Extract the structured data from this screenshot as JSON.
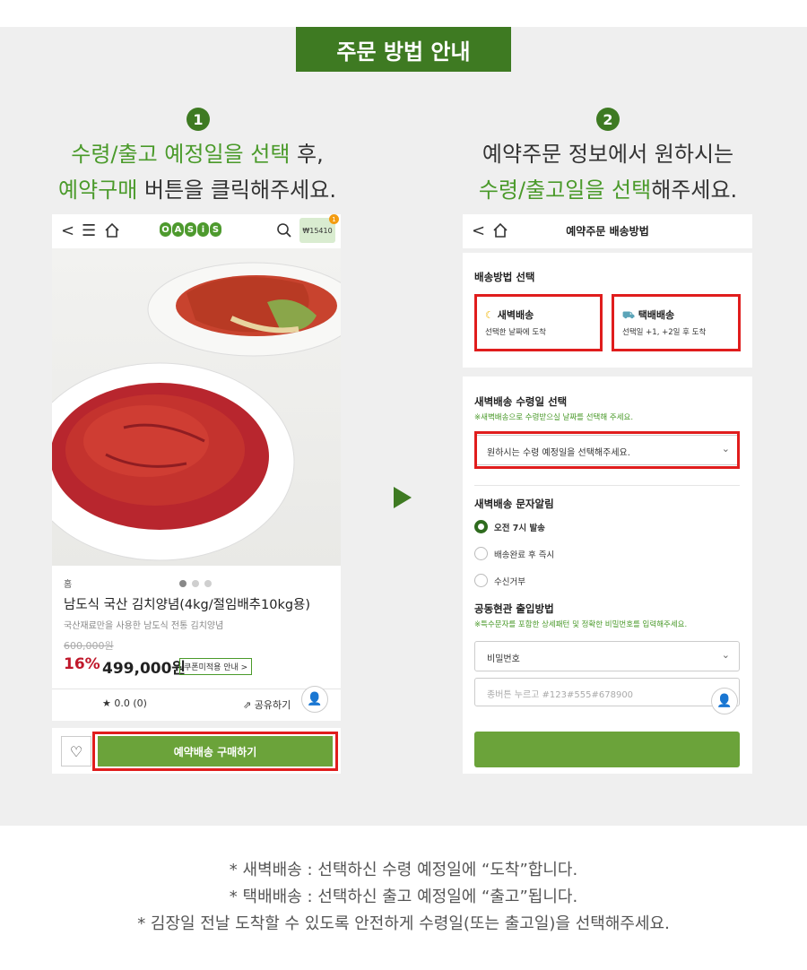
{
  "title": "주문 방법 안내",
  "steps": [
    {
      "number": "1",
      "line1_green": "수령/출고 예정일을 선택",
      "line1_rest": " 후,",
      "line2_green": "예약구매",
      "line2_rest": " 버튼을 클릭해주세요."
    },
    {
      "number": "2",
      "line1": "예약주문 정보에서 원하시는",
      "line2_green": "수령/출고일을 선택",
      "line2_rest": "해주세요."
    }
  ],
  "left_phone": {
    "logo_letters": [
      "O",
      "A",
      "S",
      "i",
      "S"
    ],
    "wallet": "₩15410",
    "wallet_badge": "1",
    "category": "홈",
    "product_name": "남도식 국산 김치양념(4kg/절임배추10kg용)",
    "product_desc": "국산재료만을 사용한 남도식 전통 김치양념",
    "original_price": "600,000원",
    "discount": "16%",
    "price": "499,000원",
    "coupon": "쿠폰미적용 안내 >",
    "rating": "★ 0.0 (0)",
    "share": "⇗ 공유하기",
    "buy_button": "예약배송 구매하기",
    "image_dots": 3,
    "image_dot_active": 1
  },
  "right_phone": {
    "header_title": "예약주문 배송방법",
    "delivery_section_title": "배송방법 선택",
    "options": [
      {
        "icon": "moon-icon",
        "title": "새벽배송",
        "sub": "선택한 날짜에 도착"
      },
      {
        "icon": "truck-icon",
        "title": "택배배송",
        "sub": "선택일 +1, +2일 후 도착"
      }
    ],
    "date_section_title": "새벽배송 수령일 선택",
    "date_section_note": "※새벽배송으로 수령받으실 날짜를 선택해 주세요.",
    "date_select_placeholder": "원하시는 수령 예정일을 선택해주세요.",
    "sms_section_title": "새벽배송 문자알림",
    "sms_options": [
      "오전 7시 발송",
      "배송완료 후 즉시",
      "수신거부"
    ],
    "sms_selected": 0,
    "entrance_section_title": "공동현관 출입방법",
    "entrance_note": "※특수문자를 포함한 상세패턴 및 정확한 비밀번호를 입력해주세요.",
    "entrance_select": "비밀번호",
    "entrance_input_placeholder": "종버튼 누르고 #123#555#678900"
  },
  "footnotes": [
    "* 새벽배송 : 선택하신 수령 예정일에 “도착”합니다.",
    "* 택배배송 : 선택하신 출고 예정일에 “출고”됩니다.",
    "* 김장일 전날 도착할 수 있도록 안전하게 수령일(또는 출고일)을 선택해주세요."
  ],
  "colors": {
    "brand_green": "#3e7a22",
    "accent_green": "#4a9a2a",
    "button_green": "#6ba33a",
    "highlight_red": "#e01d1d",
    "discount_red": "#c0182b"
  }
}
